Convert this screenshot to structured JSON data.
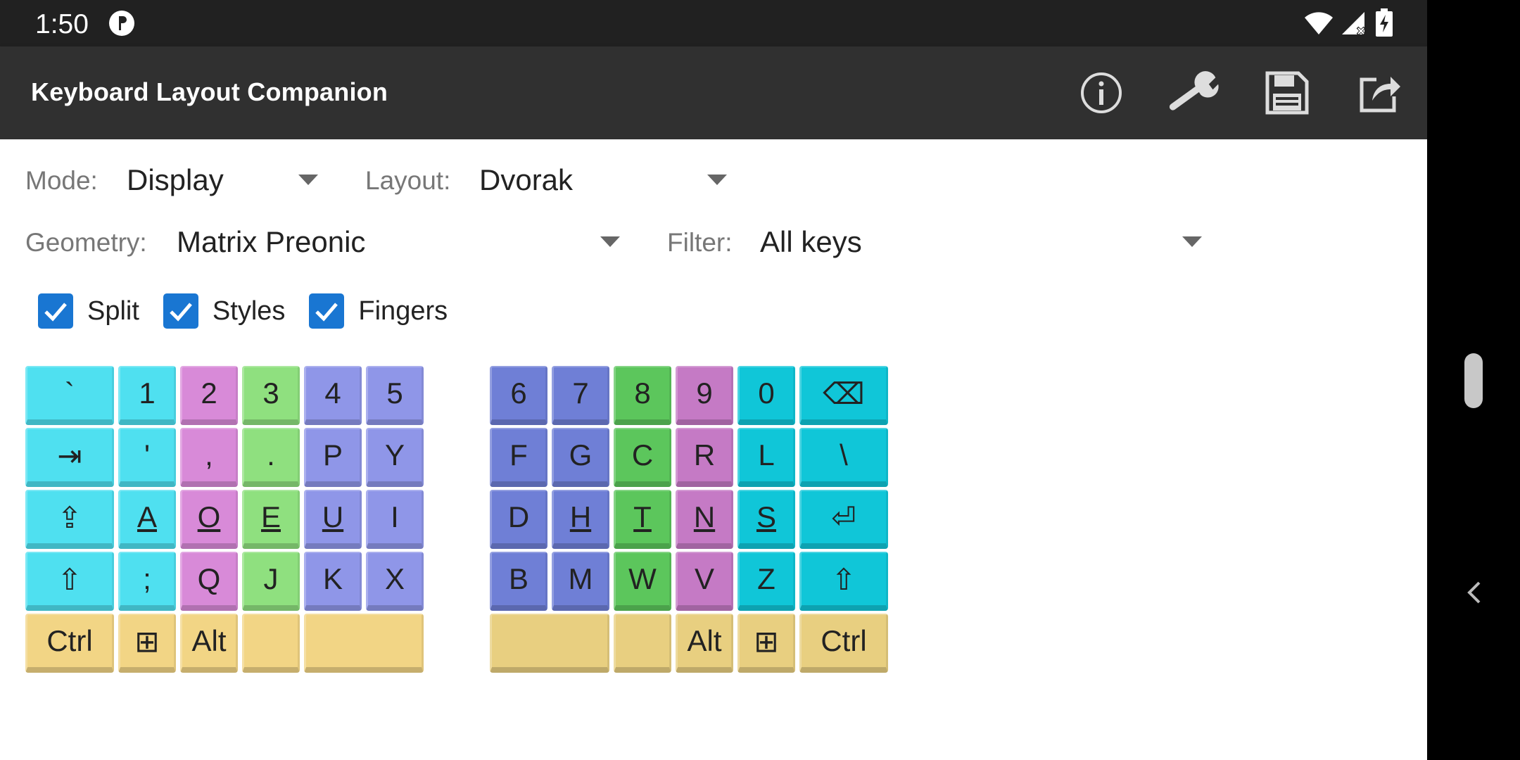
{
  "status_bar": {
    "time": "1:50"
  },
  "app_bar": {
    "title": "Keyboard Layout Companion",
    "actions": [
      {
        "icon": "info-icon"
      },
      {
        "icon": "wrench-icon"
      },
      {
        "icon": "save-icon"
      },
      {
        "icon": "share-icon"
      }
    ]
  },
  "controls": {
    "mode": {
      "label": "Mode:",
      "value": "Display"
    },
    "layout": {
      "label": "Layout:",
      "value": "Dvorak"
    },
    "geometry": {
      "label": "Geometry:",
      "value": "Matrix Preonic"
    },
    "filter": {
      "label": "Filter:",
      "value": "All keys"
    }
  },
  "checkboxes": [
    {
      "label": "Split",
      "checked": true
    },
    {
      "label": "Styles",
      "checked": true
    },
    {
      "label": "Fingers",
      "checked": true
    }
  ],
  "colors": {
    "pinky": "#4fe0f0",
    "ring": "#d88ad8",
    "middle": "#8fe07f",
    "index": "#8f96e8",
    "index_dark": "#6f7fd6",
    "middle_dark": "#5cc65c",
    "ring_dark": "#c57ac5",
    "pinky_dark": "#10c6d8",
    "thumb": "#f2d585",
    "thumb_dark": "#e8cf80"
  },
  "keyboard": {
    "left": [
      [
        "`",
        "1",
        "2",
        "3",
        "4",
        "5"
      ],
      [
        "⇥",
        "'",
        ",",
        ".",
        "P",
        "Y"
      ],
      [
        "⇪",
        "A",
        "O",
        "E",
        "U",
        "I"
      ],
      [
        "⇧",
        ";",
        "Q",
        "J",
        "K",
        "X"
      ],
      [
        "Ctrl",
        "⊞",
        "Alt",
        "",
        ""
      ]
    ],
    "right": [
      [
        "6",
        "7",
        "8",
        "9",
        "0",
        "⌫"
      ],
      [
        "F",
        "G",
        "C",
        "R",
        "L",
        "\\"
      ],
      [
        "D",
        "H",
        "T",
        "N",
        "S",
        "⏎"
      ],
      [
        "B",
        "M",
        "W",
        "V",
        "Z",
        "⇧"
      ],
      [
        "",
        "",
        "Alt",
        "⊞",
        "Ctrl"
      ]
    ],
    "home_row_underlined": [
      "A",
      "O",
      "E",
      "U",
      "H",
      "T",
      "N",
      "S"
    ]
  }
}
